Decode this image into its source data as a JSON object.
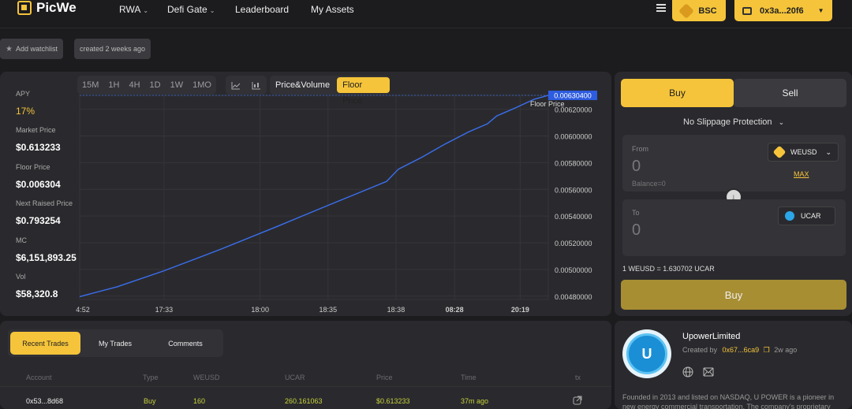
{
  "nav": {
    "logo": "PicWe",
    "items": [
      {
        "label": "RWA",
        "dropdown": true
      },
      {
        "label": "Defi Gate",
        "dropdown": true
      },
      {
        "label": "Leaderboard",
        "dropdown": false
      },
      {
        "label": "My Assets",
        "dropdown": false
      }
    ],
    "chain": "BSC",
    "wallet": "0x3a...20f6"
  },
  "chips": {
    "watchlist": "Add watchlist",
    "created": "created 2 weeks ago"
  },
  "stats": {
    "apy_label": "APY",
    "apy_value": "17%",
    "market_price_label": "Market Price",
    "market_price_value": "$0.613233",
    "floor_price_label": "Floor Price",
    "floor_price_value": "$0.006304",
    "next_raised_label": "Next Raised Price",
    "next_raised_value": "$0.793254",
    "mc_label": "MC",
    "mc_value": "$6,151,893.25",
    "vol_label": "Vol",
    "vol_value": "$58,320.8"
  },
  "chart_controls": {
    "timeframes": [
      "15M",
      "1H",
      "4H",
      "1D",
      "1W",
      "1MO"
    ],
    "modes": [
      "Price&Volume",
      "Floor Price"
    ],
    "active_mode": "Floor Price"
  },
  "chart_data": {
    "type": "line",
    "series": [
      {
        "name": "Floor Price",
        "x_labels": [
          "4:52",
          "17:33",
          "18:00",
          "18:35",
          "18:38",
          "08:28",
          "20:19"
        ],
        "points": [
          [
            0.0,
            0.004796
          ],
          [
            0.08,
            0.00487
          ],
          [
            0.18,
            0.00499
          ],
          [
            0.3,
            0.00515
          ],
          [
            0.42,
            0.00532
          ],
          [
            0.53,
            0.00548
          ],
          [
            0.6,
            0.00558
          ],
          [
            0.655,
            0.00566
          ],
          [
            0.68,
            0.00575
          ],
          [
            0.73,
            0.00584
          ],
          [
            0.78,
            0.00594
          ],
          [
            0.83,
            0.00603
          ],
          [
            0.87,
            0.00609
          ],
          [
            0.89,
            0.00615
          ],
          [
            0.93,
            0.00621
          ],
          [
            0.97,
            0.006275
          ],
          [
            1.0,
            0.006304
          ]
        ]
      }
    ],
    "y_ticks": [
      "0.00620000",
      "0.00600000",
      "0.00580000",
      "0.00560000",
      "0.00540000",
      "0.00520000",
      "0.00500000",
      "0.00480000"
    ],
    "y_tick_values": [
      0.0062,
      0.006,
      0.0058,
      0.0056,
      0.0054,
      0.0052,
      0.005,
      0.0048
    ],
    "ylim": [
      0.004775,
      0.006304
    ],
    "current_value_label": "0.00630400",
    "series_label": "Floor Price",
    "line_color": "#3b6ff0",
    "grid": true
  },
  "trade": {
    "tab_buy": "Buy",
    "tab_sell": "Sell",
    "slippage": "No Slippage Protection",
    "from_label": "From",
    "from_amount": "0",
    "from_token": "WEUSD",
    "balance": "Balance=0",
    "max": "MAX",
    "to_label": "To",
    "to_amount": "0",
    "to_token": "UCAR",
    "rate": "1 WEUSD = 1.630702 UCAR",
    "buy_button": "Buy"
  },
  "trades": {
    "tabs": [
      "Recent Trades",
      "My Trades",
      "Comments"
    ],
    "headers": [
      "Account",
      "Type",
      "WEUSD",
      "UCAR",
      "Price",
      "Time",
      "tx"
    ],
    "rows": [
      [
        "0x53...8d68",
        "Buy",
        "160",
        "260.161063",
        "$0.613233",
        "37m ago"
      ]
    ]
  },
  "project": {
    "name": "UpowerLimited",
    "created_by_label": "Created by",
    "creator": "0x67...6ca9",
    "age": "2w ago",
    "logo_text": "U",
    "description": "Founded in 2013 and listed on NASDAQ, U POWER is a pioneer in new energy commercial transportation. The company's proprietary"
  },
  "colors": {
    "accent": "#f5c43a",
    "buy_green": "#c8d23a",
    "line": "#3b6ff0"
  }
}
